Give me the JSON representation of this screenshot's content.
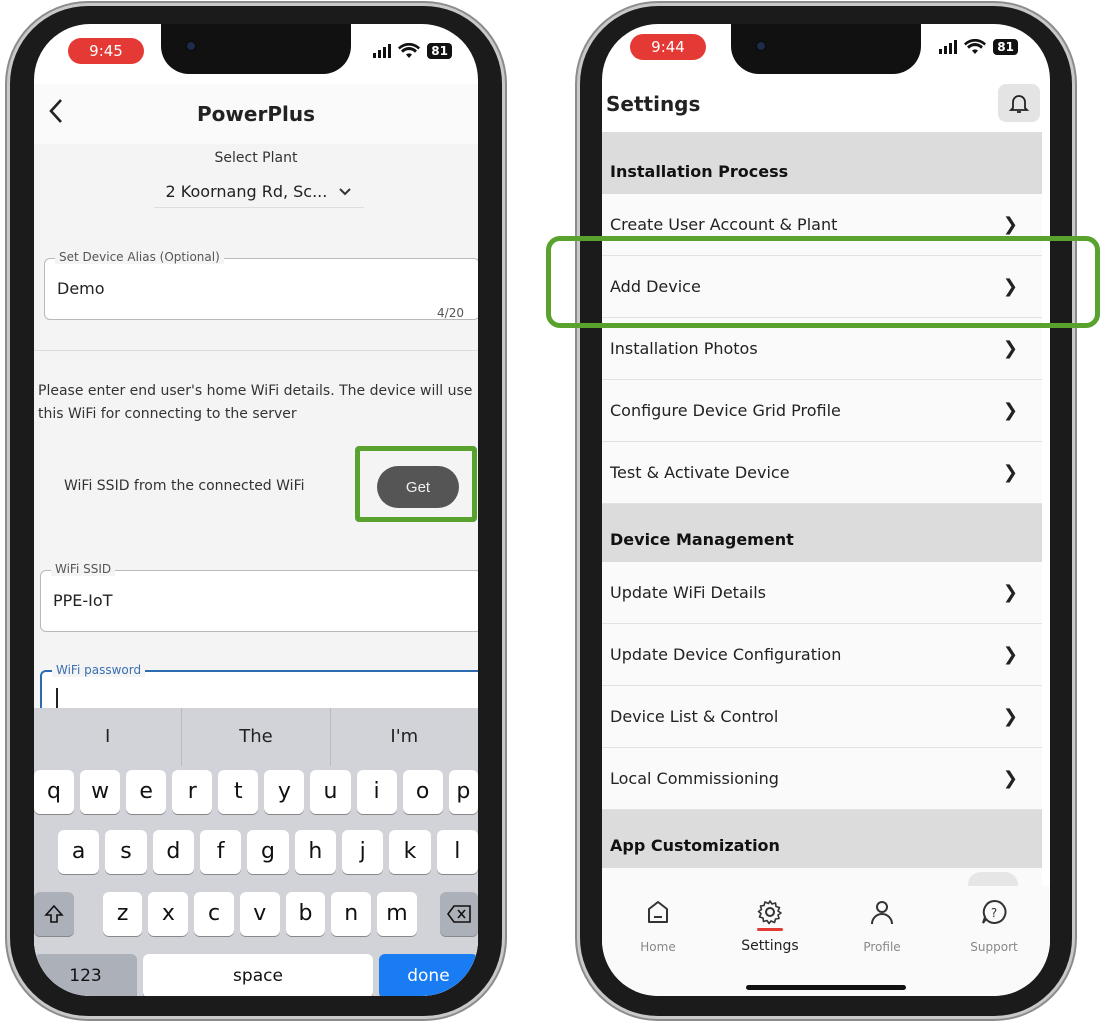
{
  "left_phone": {
    "status_time": "9:45",
    "battery": "81",
    "header": {
      "back_icon": "chevron-left-icon",
      "title": "PowerPlus"
    },
    "select_plant": {
      "label": "Select Plant",
      "value": "2 Koornang Rd, Sc..."
    },
    "alias_field": {
      "legend": "Set Device Alias (Optional)",
      "value": "Demo",
      "counter": "4/20"
    },
    "info_text": "Please enter end user's home WiFi details. The device will use this WiFi for connecting to the server",
    "ssid_row": {
      "label": "WiFi SSID from the connected WiFi",
      "get_button": "Get"
    },
    "ssid_field": {
      "legend": "WiFi SSID",
      "value": "PPE-IoT"
    },
    "password_field": {
      "legend": "WiFi password",
      "value": ""
    },
    "keyboard": {
      "suggestions": [
        "I",
        "The",
        "I'm"
      ],
      "row1": [
        "q",
        "w",
        "e",
        "r",
        "t",
        "y",
        "u",
        "i",
        "o",
        "p"
      ],
      "row2": [
        "a",
        "s",
        "d",
        "f",
        "g",
        "h",
        "j",
        "k",
        "l"
      ],
      "row3": [
        "z",
        "x",
        "c",
        "v",
        "b",
        "n",
        "m"
      ],
      "numbers_key": "123",
      "space_key": "space",
      "done_key": "done"
    }
  },
  "right_phone": {
    "status_time": "9:44",
    "battery": "81",
    "header": {
      "title": "Settings",
      "bell_icon": "bell-icon"
    },
    "sections": [
      {
        "title": "Installation Process",
        "items": [
          "Create User Account & Plant",
          "Add Device",
          "Installation Photos",
          "Configure Device Grid Profile",
          "Test & Activate Device"
        ]
      },
      {
        "title": "Device Management",
        "items": [
          "Update WiFi Details",
          "Update Device Configuration",
          "Device List & Control",
          "Local Commissioning"
        ]
      },
      {
        "title": "App Customization",
        "items": []
      }
    ],
    "tabs": [
      {
        "label": "Home",
        "icon": "home-icon"
      },
      {
        "label": "Settings",
        "icon": "gear-icon",
        "active": true
      },
      {
        "label": "Profile",
        "icon": "person-icon"
      },
      {
        "label": "Support",
        "icon": "help-icon"
      }
    ]
  },
  "colors": {
    "highlight": "#5aa22e",
    "accent": "#e53935"
  }
}
